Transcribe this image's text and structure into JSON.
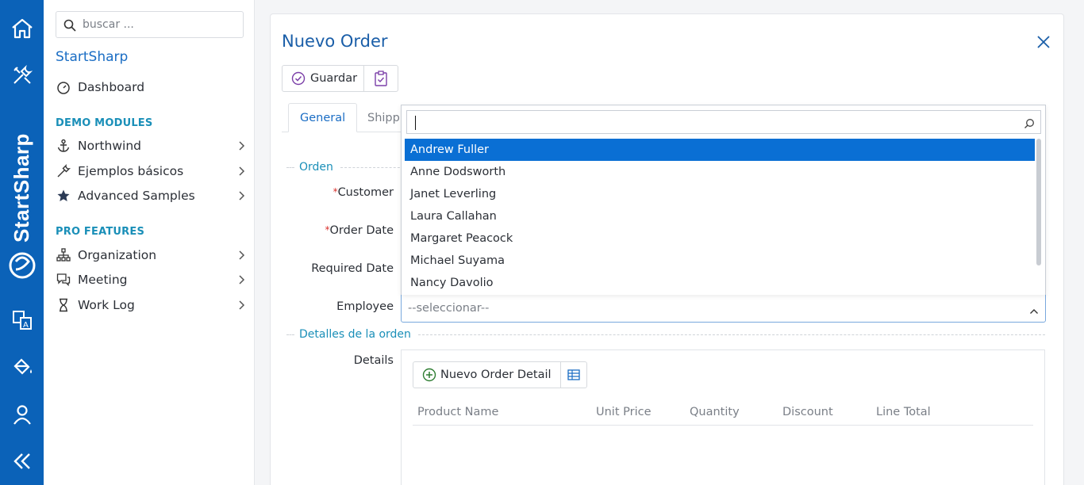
{
  "colors": {
    "rail": "#0b62b8",
    "accent": "#1a6dc4",
    "selected": "#0a6fd4",
    "section": "#1a8fb8"
  },
  "rail": {
    "brand_text": "StartSharp",
    "icons": [
      "home-icon",
      "tools-icon",
      "translate-icon",
      "paint-bucket-icon",
      "user-icon",
      "collapse-icon"
    ]
  },
  "sidebar": {
    "search_placeholder": "buscar ...",
    "brand": "StartSharp",
    "dashboard": "Dashboard",
    "section_demo": "DEMO MODULES",
    "northwind": "Northwind",
    "basic_samples": "Ejemplos básicos",
    "advanced_samples": "Advanced Samples",
    "section_pro": "PRO FEATURES",
    "organization": "Organization",
    "meeting": "Meeting",
    "work_log": "Work Log"
  },
  "dialog": {
    "title": "Nuevo Order",
    "save_label": "Guardar",
    "tab_general": "General",
    "tab_shipping": "Shippi",
    "category_order": "Orden",
    "label_customer": "Customer",
    "label_order_date": "Order Date",
    "label_required_date": "Required Date",
    "label_employee": "Employee",
    "required_mark": "*",
    "category_details": "Detalles de la orden",
    "label_details": "Details"
  },
  "employee_select": {
    "placeholder": "--seleccionar--",
    "search_value": "",
    "options": [
      "Andrew Fuller",
      "Anne Dodsworth",
      "Janet Leverling",
      "Laura Callahan",
      "Margaret Peacock",
      "Michael Suyama",
      "Nancy Davolio"
    ],
    "highlighted": "Andrew Fuller"
  },
  "details_grid": {
    "new_button": "Nuevo Order Detail",
    "columns": [
      "Product Name",
      "Unit Price",
      "Quantity",
      "Discount",
      "Line Total"
    ]
  }
}
